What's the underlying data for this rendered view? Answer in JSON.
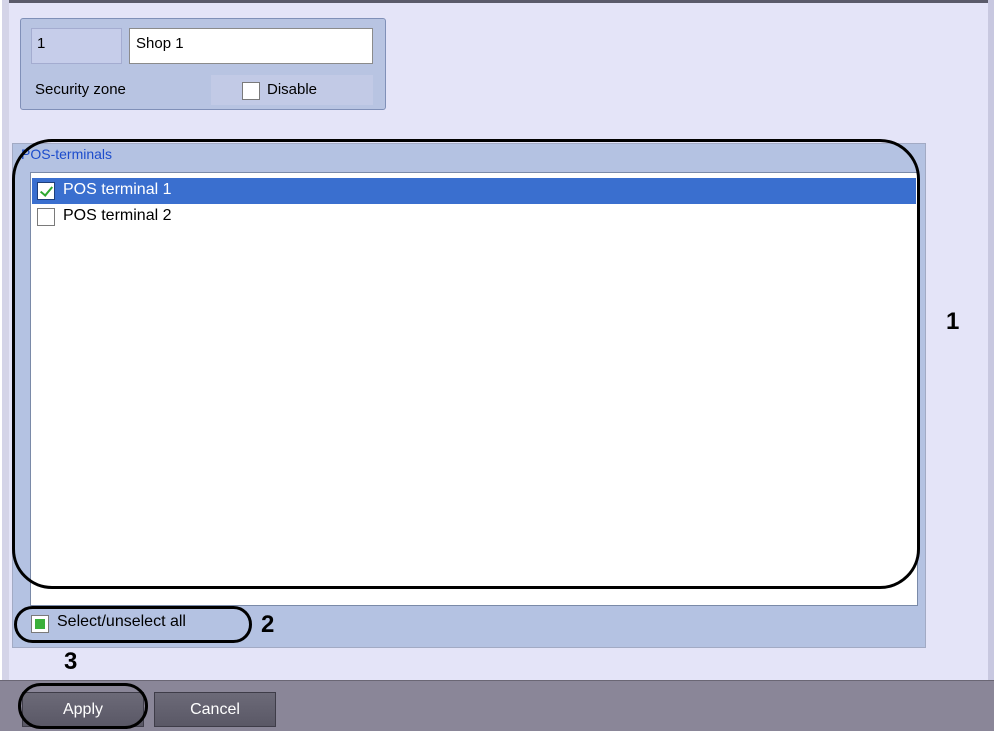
{
  "security_zone": {
    "id_value": "1",
    "name_value": "Shop 1",
    "zone_label": "Security zone",
    "disable_label": "Disable",
    "disable_checked": false
  },
  "pos_terminals": {
    "group_title": "POS-terminals",
    "items": [
      {
        "label": "POS terminal 1",
        "checked": true,
        "selected": true
      },
      {
        "label": "POS terminal 2",
        "checked": false,
        "selected": false
      }
    ],
    "select_all_label": "Select/unselect all",
    "select_all_state": "partial"
  },
  "buttons": {
    "apply_label": "Apply",
    "cancel_label": "Cancel"
  },
  "callouts": {
    "one": "1",
    "two": "2",
    "three": "3"
  }
}
